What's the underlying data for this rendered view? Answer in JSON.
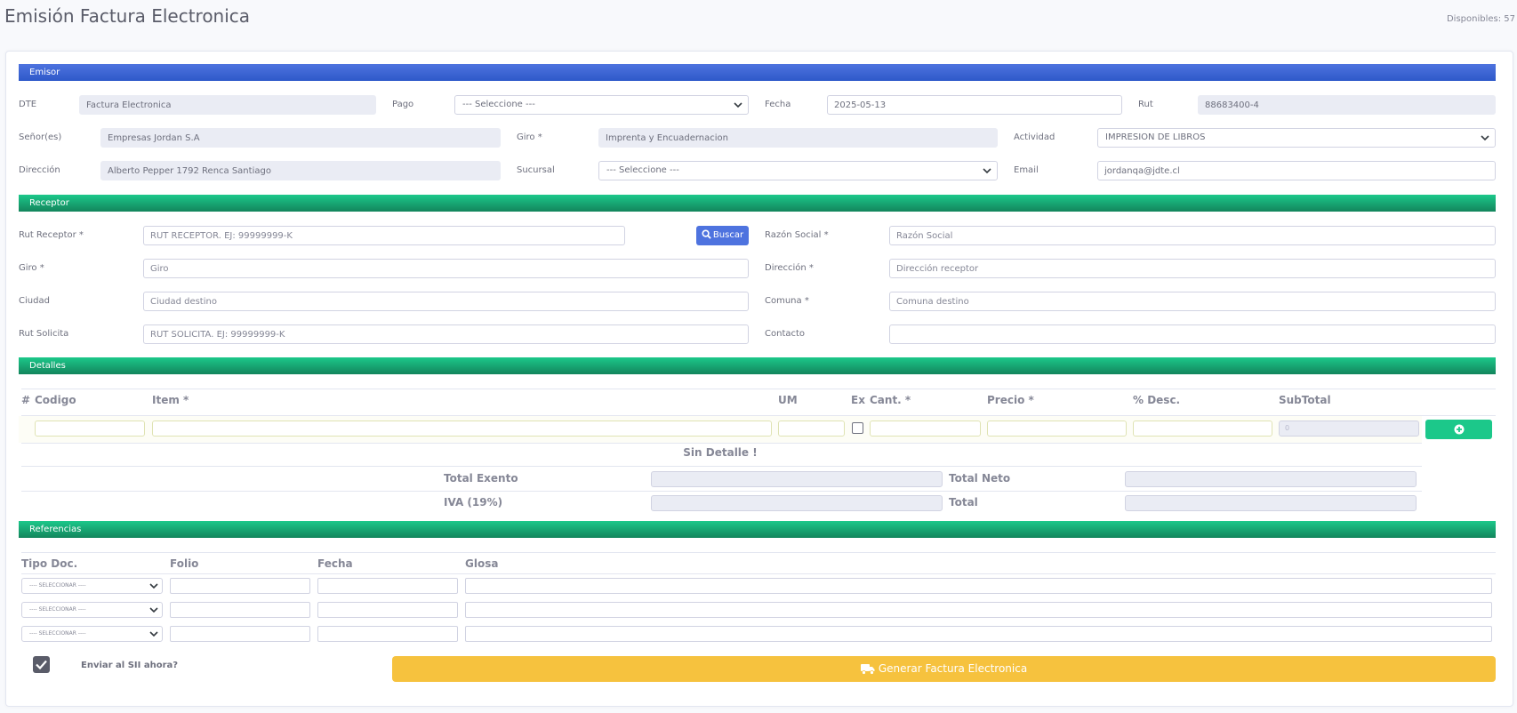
{
  "page": {
    "title": "Emisión Factura Electronica",
    "disponibles": "Disponibles: 57"
  },
  "emisor": {
    "section_title": "Emisor",
    "dte_label": "DTE",
    "dte_value": "Factura Electronica",
    "pago_label": "Pago",
    "pago_value": "--- Seleccione ---",
    "fecha_label": "Fecha",
    "fecha_value": "2025-05-13",
    "rut_label": "Rut",
    "rut_value": "88683400-4",
    "senores_label": "Señor(es)",
    "senores_value": "Empresas Jordan S.A",
    "giro_label": "Giro *",
    "giro_value": "Imprenta y Encuadernacion",
    "actividad_label": "Actividad",
    "actividad_value": "IMPRESION DE LIBROS",
    "direccion_label": "Dirección",
    "direccion_value": "Alberto Pepper 1792 Renca Santiago",
    "sucursal_label": "Sucursal",
    "sucursal_value": "--- Seleccione ---",
    "email_label": "Email",
    "email_value": "jordanqa@jdte.cl"
  },
  "receptor": {
    "section_title": "Receptor",
    "rut_label": "Rut Receptor *",
    "rut_placeholder": "RUT RECEPTOR. EJ: 99999999-K",
    "buscar_label": "Buscar",
    "razon_label": "Razón Social *",
    "razon_placeholder": "Razón Social",
    "giro_label": "Giro *",
    "giro_placeholder": "Giro",
    "direccion_label": "Dirección *",
    "direccion_placeholder": "Dirección receptor",
    "ciudad_label": "Ciudad",
    "ciudad_placeholder": "Ciudad destino",
    "comuna_label": "Comuna *",
    "comuna_placeholder": "Comuna destino",
    "rut_solicita_label": "Rut Solicita",
    "rut_solicita_placeholder": "RUT SOLICITA. EJ: 99999999-K",
    "contacto_label": "Contacto",
    "contacto_value": ""
  },
  "detalles": {
    "section_title": "Detalles",
    "columns": [
      "#",
      "Codigo",
      "Item *",
      "UM",
      "Ex",
      "Cant. *",
      "Precio *",
      "% Desc.",
      "SubTotal"
    ],
    "subtotal_value": "0",
    "empty_message": "Sin Detalle !",
    "total_exento_label": "Total Exento",
    "total_neto_label": "Total Neto",
    "iva_label": "IVA (19%)",
    "total_label": "Total"
  },
  "referencias": {
    "section_title": "Referencias",
    "columns": [
      "Tipo Doc.",
      "Folio",
      "Fecha",
      "Glosa"
    ],
    "select_placeholder": "---- SELECCIONAR ----"
  },
  "footer": {
    "enviar_label": "Enviar al SII ahora?",
    "enviar_checked": true,
    "generar_label": "Generar Factura Electronica"
  },
  "icons": {
    "search": "search-icon",
    "add": "plus-circle-icon",
    "truck": "truck-icon",
    "check": "check-icon",
    "chevron": "chevron-down-icon"
  },
  "colors": {
    "emisor_bar": "#4e73df",
    "section_bar": "#1cc88a",
    "generar_button": "#f6c23e",
    "buscar_button": "#4e73df"
  }
}
